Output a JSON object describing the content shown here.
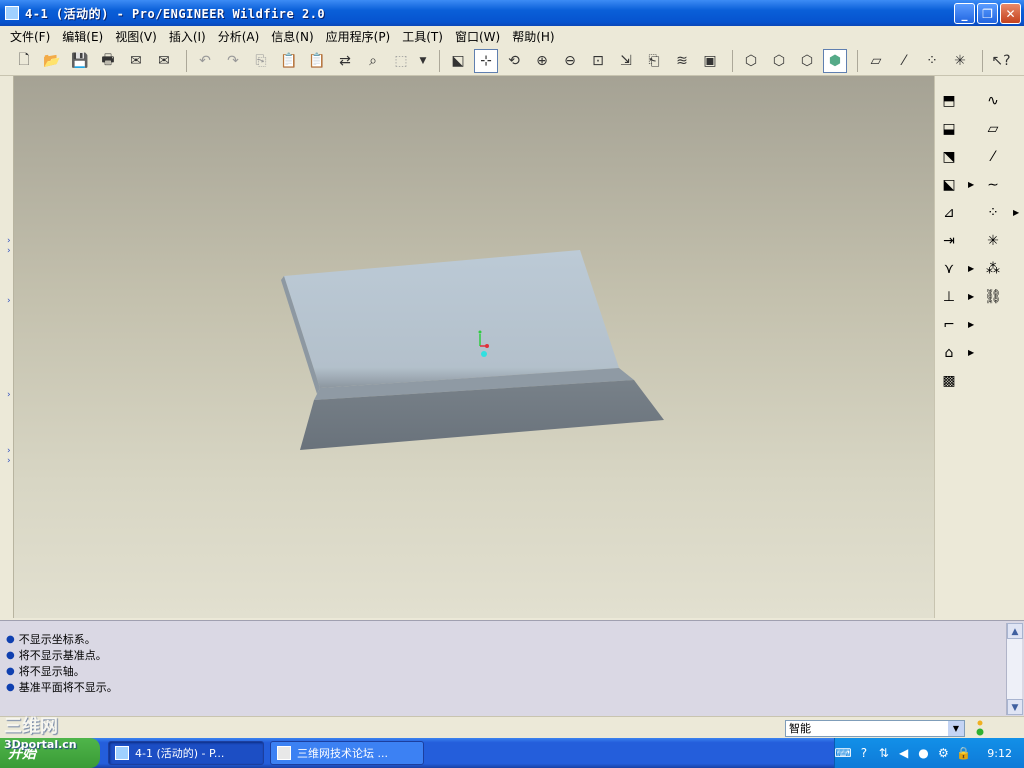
{
  "window": {
    "title": "4-1 (活动的) - Pro/ENGINEER Wildfire 2.0",
    "minimize": "_",
    "restore": "❐",
    "close": "✕"
  },
  "menu": [
    "文件(F)",
    "编辑(E)",
    "视图(V)",
    "插入(I)",
    "分析(A)",
    "信息(N)",
    "应用程序(P)",
    "工具(T)",
    "窗口(W)",
    "帮助(H)"
  ],
  "toolbar_icons": [
    "new-file-icon",
    "open-folder-icon",
    "save-icon",
    "print-icon",
    "email-icon",
    "email-attach-icon",
    "undo-icon",
    "redo-icon",
    "copy-icon",
    "paste-icon",
    "paste-special-icon",
    "regenerate-icon",
    "find-icon",
    "select-box-icon",
    "redraw-icon",
    "spin-center-icon",
    "orient-mode-icon",
    "zoom-in-icon",
    "zoom-out-icon",
    "refit-icon",
    "reorient-icon",
    "saved-views-icon",
    "layers-icon",
    "view-manager-icon",
    "wireframe-icon",
    "hidden-line-icon",
    "no-hidden-icon",
    "shading-icon",
    "datum-planes-toggle-icon",
    "datum-axes-toggle-icon",
    "datum-points-toggle-icon",
    "coord-sys-toggle-icon",
    "context-help-icon"
  ],
  "messages": [
    "不显示坐标系。",
    "将不显示基准点。",
    "将不显示轴。",
    "基准平面将不显示。"
  ],
  "status": {
    "filter_value": "智能"
  },
  "taskbar": {
    "start_label": "开始",
    "task1": "4-1 (活动的) - P...",
    "task2": "三维网技术论坛 ...",
    "clock": "9:12"
  },
  "watermark": {
    "line1": "三维网",
    "line2": "3Dportal.cn"
  },
  "colors": {
    "part_top": "#b8c5d0",
    "part_front": "#6f7881",
    "viewport_top": "#a5a294",
    "viewport_bottom": "#e2e0d0"
  }
}
